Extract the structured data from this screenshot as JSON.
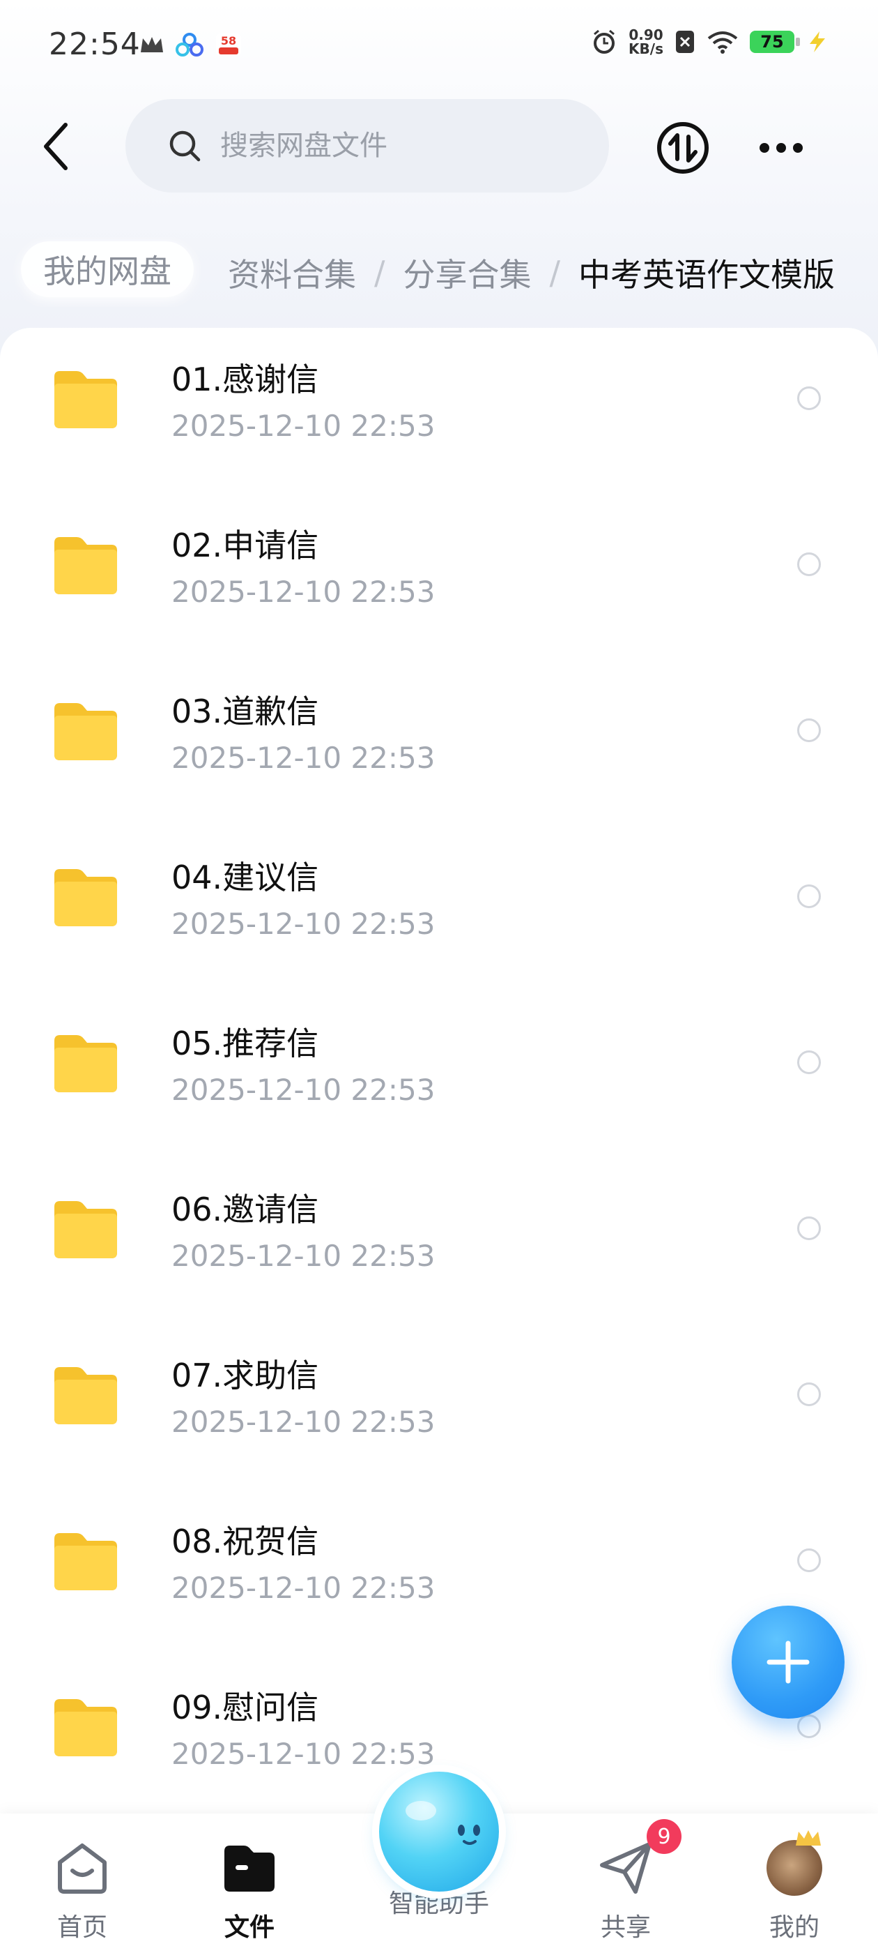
{
  "status_bar": {
    "time": "22:54",
    "net_speed_value": "0.90",
    "net_speed_unit": "KB/s",
    "battery": "75",
    "icons": [
      "crown-icon",
      "cloud-app-icon",
      "58-app-icon",
      "alarm-icon",
      "close-box-icon",
      "wifi-icon",
      "battery-icon",
      "charging-icon"
    ]
  },
  "header": {
    "search_placeholder": "搜索网盘文件"
  },
  "breadcrumb": {
    "home": "我的网盘",
    "items": [
      "资料合集",
      "分享合集"
    ],
    "current": "中考英语作文模版",
    "separator": "/"
  },
  "files": [
    {
      "name": "01.感谢信",
      "date": "2025-12-10  22:53"
    },
    {
      "name": "02.申请信",
      "date": "2025-12-10  22:53"
    },
    {
      "name": "03.道歉信",
      "date": "2025-12-10  22:53"
    },
    {
      "name": "04.建议信",
      "date": "2025-12-10  22:53"
    },
    {
      "name": "05.推荐信",
      "date": "2025-12-10  22:53"
    },
    {
      "name": "06.邀请信",
      "date": "2025-12-10  22:53"
    },
    {
      "name": "07.求助信",
      "date": "2025-12-10  22:53"
    },
    {
      "name": "08.祝贺信",
      "date": "2025-12-10  22:53"
    },
    {
      "name": "09.慰问信",
      "date": "2025-12-10  22:53"
    }
  ],
  "bottom_nav": {
    "home": "首页",
    "files": "文件",
    "assistant": "智能助手",
    "share": "共享",
    "mine": "我的",
    "share_badge": "9"
  },
  "colors": {
    "accent": "#2f9bf7",
    "folder": "#ffd54a",
    "badge": "#f23b5c"
  }
}
